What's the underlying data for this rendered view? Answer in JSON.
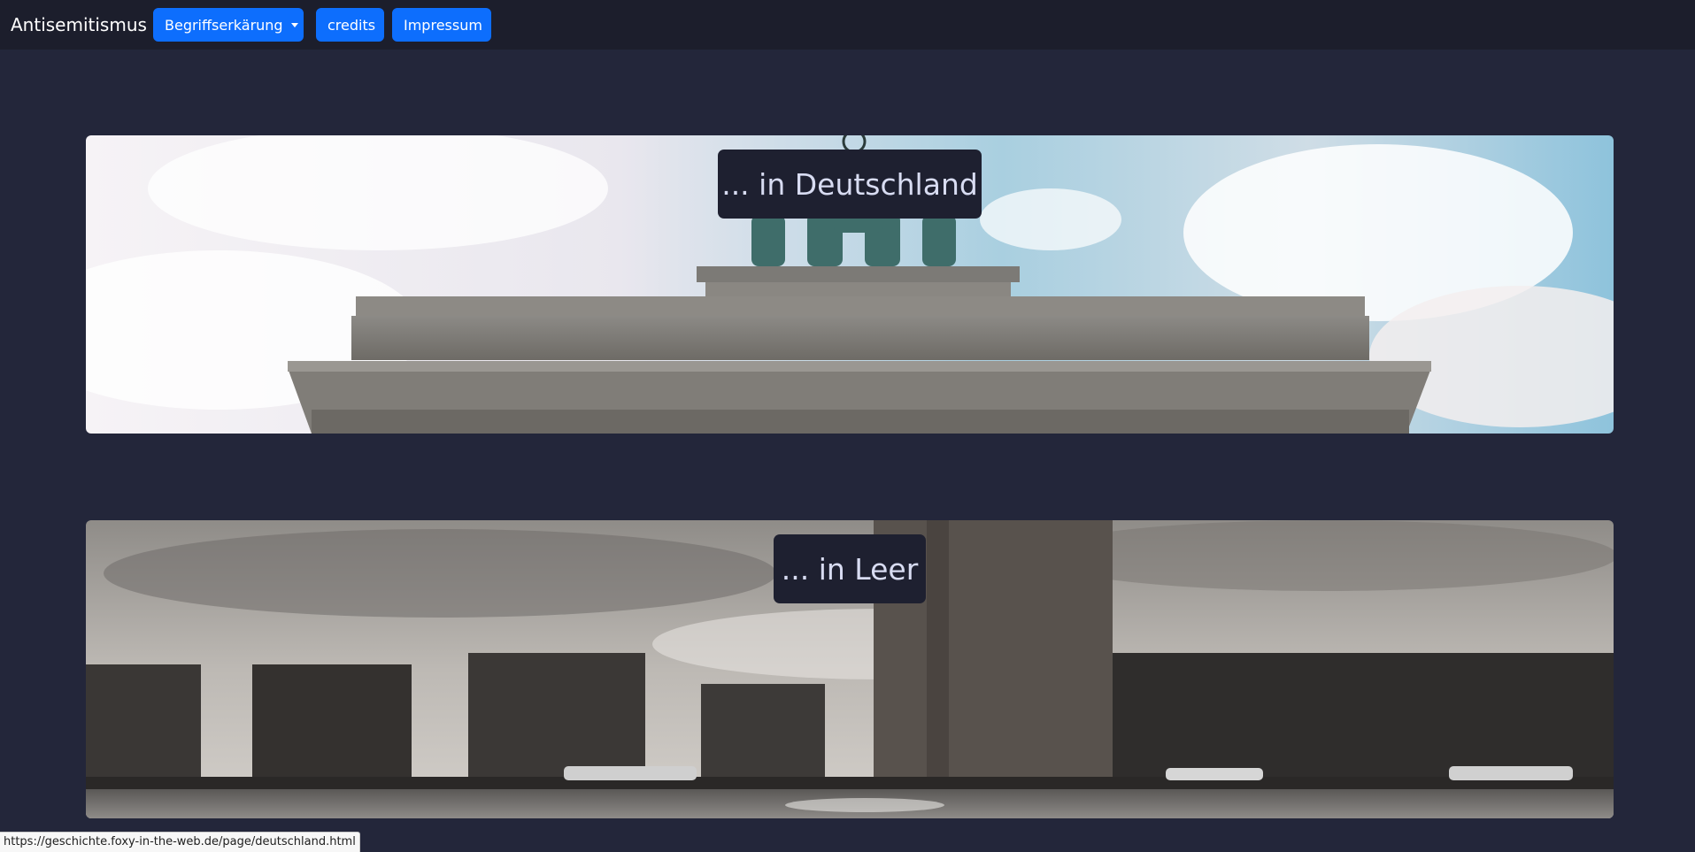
{
  "navbar": {
    "brand": "Antisemitismus",
    "buttons": [
      {
        "label": "Begriffserkärung",
        "dropdown": true
      },
      {
        "label": "credits"
      },
      {
        "label": "Impressum"
      }
    ],
    "button_color": "#0d6efd"
  },
  "cards": [
    {
      "title": "... in Deutschland",
      "image": "brandenburg-gate-photo"
    },
    {
      "title": "... in Leer",
      "image": "leer-harbor-photo"
    }
  ],
  "status_bar": {
    "url": "https://geschichte.foxy-in-the-web.de/page/deutschland.html"
  },
  "colors": {
    "page_background": "#23263a",
    "navbar_background": "#1c1e2c",
    "title_box": "#1e2030"
  }
}
